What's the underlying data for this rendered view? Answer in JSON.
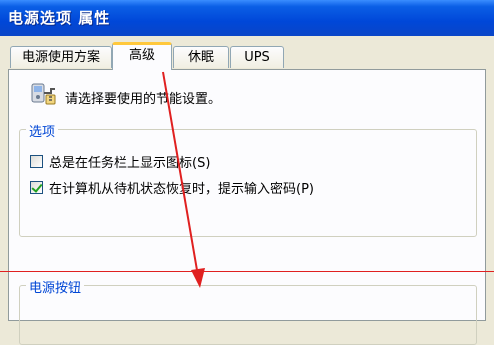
{
  "window": {
    "title": "电源选项 属性"
  },
  "tabs": [
    {
      "label": "电源使用方案"
    },
    {
      "label": "高级"
    },
    {
      "label": "休眠"
    },
    {
      "label": "UPS"
    }
  ],
  "panel": {
    "intro": "请选择要使用的节能设置。",
    "options_group": {
      "label": "选项",
      "items": [
        {
          "label": "总是在任务栏上显示图标(S)",
          "checked": false
        },
        {
          "label": "在计算机从待机状态恢复时，提示输入密码(P)",
          "checked": true
        }
      ]
    },
    "power_buttons_group": {
      "label": "电源按钮"
    }
  },
  "colors": {
    "titlebar": "#0047D8",
    "group_label": "#0046D5",
    "annotation": "#E02020",
    "tab_highlight": "#FFC83C"
  },
  "icons": {
    "power": "power-options-icon",
    "check": "checkmark-icon"
  }
}
